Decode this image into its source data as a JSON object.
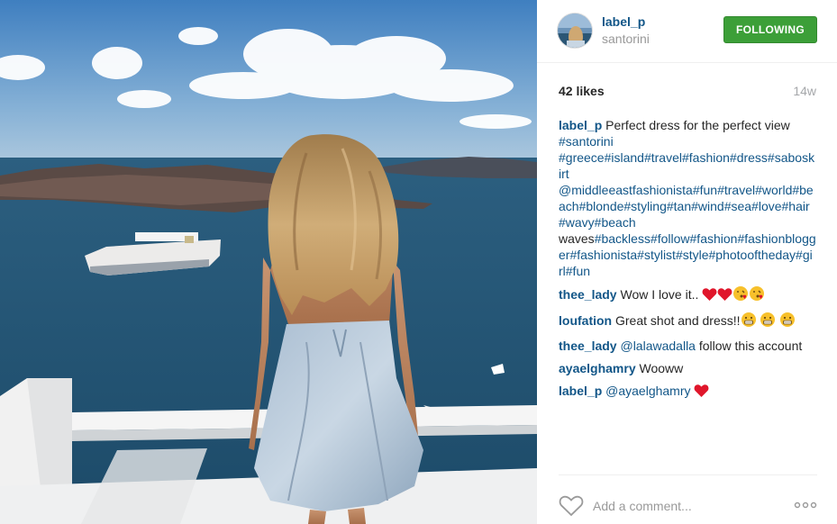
{
  "post": {
    "username": "label_p",
    "location": "santorini",
    "follow_label": "FOLLOWING",
    "likes": "42 likes",
    "time": "14w"
  },
  "caption": {
    "user": "label_p",
    "text": "Perfect dress for the perfect view",
    "tags_line1": "#santorini",
    "tags_line2": "#greece#island#travel#fashion#dress#saboskirt",
    "tags_line3": "@middleeastfashionista#fun#travel#world#beach#blonde#styling#tan#wind#sea#love#hair#wavy#beach",
    "word_waves": "waves",
    "tags_line4": "#backless#follow#fashion#fashionblogger#fashionista#stylist#style#photooftheday#girl#fun"
  },
  "comments": [
    {
      "user": "thee_lady",
      "text": "Wow I love it..",
      "emojis": [
        "heart",
        "heart",
        "kiss",
        "kiss"
      ]
    },
    {
      "user": "loufation",
      "text": "Great shot and dress!!",
      "emojis": [
        "grin",
        "grin",
        "grin"
      ]
    },
    {
      "user": "thee_lady",
      "mention": "@lalawadalla",
      "text": "follow this account"
    },
    {
      "user": "ayaelghamry",
      "text": "Wooww"
    },
    {
      "user": "label_p",
      "mention": "@ayaelghamry",
      "emojis": [
        "heart"
      ]
    }
  ],
  "footer": {
    "comment_placeholder": "Add a comment...",
    "like_icon": "heart-outline-icon",
    "more_icon": "ellipsis-icon"
  },
  "colors": {
    "link": "#125688",
    "follow_button": "#3c9f38",
    "muted": "#999999",
    "heart_emoji": "#e0162b"
  }
}
